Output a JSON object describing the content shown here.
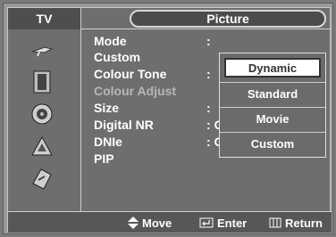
{
  "header": {
    "tab_label": "TV",
    "title": "Picture"
  },
  "sidebar": {
    "items": [
      {
        "icon": "antenna-icon"
      },
      {
        "icon": "picture-icon"
      },
      {
        "icon": "speaker-icon"
      },
      {
        "icon": "channel-icon"
      },
      {
        "icon": "setup-icon"
      }
    ]
  },
  "menu": {
    "items": [
      {
        "label": "Mode",
        "value": ":"
      },
      {
        "label": "Custom",
        "value": ""
      },
      {
        "label": "Colour Tone",
        "value": ":"
      },
      {
        "label": "Colour Adjust",
        "value": ""
      },
      {
        "label": "Size",
        "value": ":"
      },
      {
        "label": "Digital NR",
        "value": ": On"
      },
      {
        "label": "DNIe",
        "value": ": On"
      },
      {
        "label": "PIP",
        "value": ""
      }
    ]
  },
  "dropdown": {
    "options": [
      "Dynamic",
      "Standard",
      "Movie",
      "Custom"
    ],
    "selected": "Dynamic"
  },
  "footer": {
    "move_label": "Move",
    "enter_label": "Enter",
    "return_label": "Return"
  }
}
